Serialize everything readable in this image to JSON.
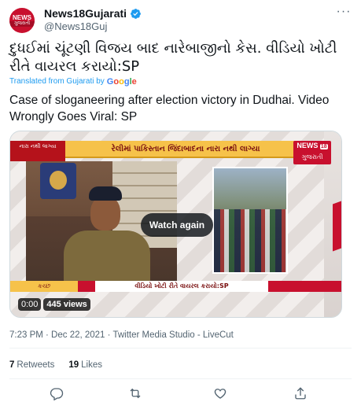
{
  "tweet": {
    "author": {
      "display_name": "News18Gujarati",
      "handle": "@News18Guj",
      "avatar_text": "NEWS",
      "avatar_subtext": "ગુજરાતી"
    },
    "original_text": "દુધઈમાં ચૂંટણી વિજય બાદ નારેબાજીનો કેસ.  વીડિયો ખોટી રીતે વાયરલ કરાયો:SP",
    "translation_label": "Translated from Gujarati by",
    "translation_provider": "Google",
    "translated_text": "Case of sloganeering after election victory in Dudhai. Video Wrongly Goes Viral: SP",
    "timestamp": "7:23 PM · Dec 22, 2021 · Twitter Media Studio - LiveCut",
    "retweets_count": "7",
    "retweets_label": "Retweets",
    "likes_count": "19",
    "likes_label": "Likes"
  },
  "media": {
    "topbar_left": "નારા નથી લાગ્યા",
    "headline": "રેલીમાં પાકિસ્તાન જિંદાબાદના નારા નથી લાગ્યા",
    "logo_text": "NEWS",
    "logo_number": "18",
    "logo_sub": "ગુજરાતી",
    "ticker_location": "કચ્છ",
    "ticker_text": "વીડિયો ખોટી રીતે વાયરલ કરાયો:SP",
    "watch_again_label": "Watch again",
    "elapsed": "0:00",
    "views": "445 views"
  },
  "colors": {
    "accent": "#1d9bf0",
    "brand_red": "#c8102e",
    "text_secondary": "#536471"
  },
  "icons": [
    "verified-badge-icon",
    "more-options-icon",
    "reply-icon",
    "retweet-icon",
    "like-icon",
    "share-icon"
  ]
}
